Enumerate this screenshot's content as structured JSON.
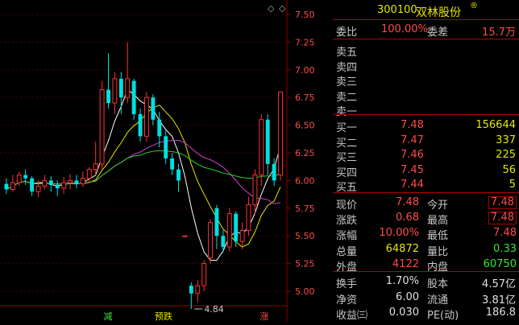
{
  "header": {
    "code": "300100",
    "name": "双林股份",
    "reg_mark": "®"
  },
  "chart": {
    "y_ticks": [
      "7.50",
      "7.25",
      "7.00",
      "6.75",
      "6.50",
      "6.25",
      "6.00",
      "5.75",
      "5.50",
      "5.25",
      "5.00"
    ],
    "low_marker": "4.84",
    "bottom_tags": [
      {
        "text": "减",
        "color": "#39e639"
      },
      {
        "text": "预跌",
        "color": "#e6e600"
      },
      {
        "text": "涨",
        "color": "#ff4b4b"
      }
    ],
    "colors": {
      "up": "#ff3232",
      "down": "#00e0e0",
      "ma5": "#ffffff",
      "ma10": "#e6e600",
      "ma20": "#d040d0",
      "ma60": "#30d030",
      "grid": "#8a0000"
    }
  },
  "panel": {
    "weibi": {
      "label": "委比",
      "value": "100.00%",
      "label2": "委差",
      "value2": "15.7万"
    },
    "sells": [
      {
        "label": "卖五",
        "price": "",
        "vol": ""
      },
      {
        "label": "卖四",
        "price": "",
        "vol": ""
      },
      {
        "label": "卖三",
        "price": "",
        "vol": ""
      },
      {
        "label": "卖二",
        "price": "",
        "vol": ""
      },
      {
        "label": "卖一",
        "price": "",
        "vol": ""
      }
    ],
    "buys": [
      {
        "label": "买一",
        "price": "7.48",
        "vol": "156644"
      },
      {
        "label": "买二",
        "price": "7.47",
        "vol": "337"
      },
      {
        "label": "买三",
        "price": "7.46",
        "vol": "225"
      },
      {
        "label": "买四",
        "price": "7.45",
        "vol": "56"
      },
      {
        "label": "买五",
        "price": "7.44",
        "vol": "5"
      }
    ],
    "stats": [
      {
        "l1": "现价",
        "v1": "7.48",
        "c1": "red",
        "l2": "今开",
        "v2": "7.48",
        "c2": "red",
        "box": true
      },
      {
        "l1": "涨跌",
        "v1": "0.68",
        "c1": "red",
        "l2": "最高",
        "v2": "7.48",
        "c2": "red",
        "box": true
      },
      {
        "l1": "涨幅",
        "v1": "10.00%",
        "c1": "red",
        "l2": "最低",
        "v2": "7.48",
        "c2": "red",
        "box": false
      },
      {
        "l1": "总量",
        "v1": "64872",
        "c1": "yellow",
        "l2": "量比",
        "v2": "0.33",
        "c2": "green",
        "box": false
      },
      {
        "l1": "外盘",
        "v1": "4122",
        "c1": "red",
        "l2": "内盘",
        "v2": "60750",
        "c2": "green",
        "box": false
      }
    ],
    "extra": [
      {
        "l1": "换手",
        "v1": "1.70%",
        "l2": "股本",
        "v2": "4.57亿"
      },
      {
        "l1": "净资",
        "v1": "6.00",
        "l2": "流通",
        "v2": "3.81亿"
      },
      {
        "l1": "收益㈢",
        "v1": "0.030",
        "l2": "PE(动)",
        "v2": "186.8"
      }
    ]
  },
  "candles": [
    {
      "o": 5.97,
      "c": 5.92,
      "h": 6.02,
      "l": 5.88
    },
    {
      "o": 5.92,
      "c": 5.98,
      "h": 6.05,
      "l": 5.9
    },
    {
      "o": 5.98,
      "c": 6.05,
      "h": 6.08,
      "l": 5.95
    },
    {
      "o": 6.05,
      "c": 6.02,
      "h": 6.1,
      "l": 5.96
    },
    {
      "o": 6.02,
      "c": 5.9,
      "h": 6.04,
      "l": 5.86
    },
    {
      "o": 5.9,
      "c": 5.95,
      "h": 6.0,
      "l": 5.85
    },
    {
      "o": 5.95,
      "c": 6.0,
      "h": 6.05,
      "l": 5.92
    },
    {
      "o": 6.0,
      "c": 5.96,
      "h": 6.04,
      "l": 5.9
    },
    {
      "o": 5.96,
      "c": 5.93,
      "h": 6.0,
      "l": 5.86
    },
    {
      "o": 5.93,
      "c": 5.98,
      "h": 6.03,
      "l": 5.88
    },
    {
      "o": 5.98,
      "c": 6.0,
      "h": 6.06,
      "l": 5.92
    },
    {
      "o": 6.0,
      "c": 5.97,
      "h": 6.05,
      "l": 5.93
    },
    {
      "o": 5.97,
      "c": 6.02,
      "h": 6.08,
      "l": 5.94
    },
    {
      "o": 6.02,
      "c": 6.1,
      "h": 6.12,
      "l": 5.98
    },
    {
      "o": 6.1,
      "c": 6.15,
      "h": 6.35,
      "l": 6.05
    },
    {
      "o": 6.15,
      "c": 6.82,
      "h": 6.9,
      "l": 6.1
    },
    {
      "o": 6.82,
      "c": 6.7,
      "h": 7.15,
      "l": 6.65
    },
    {
      "o": 6.7,
      "c": 6.92,
      "h": 6.98,
      "l": 6.6
    },
    {
      "o": 6.92,
      "c": 6.75,
      "h": 6.98,
      "l": 6.6
    },
    {
      "o": 6.75,
      "c": 6.92,
      "h": 7.25,
      "l": 6.7
    },
    {
      "o": 6.9,
      "c": 6.6,
      "h": 6.92,
      "l": 6.55
    },
    {
      "o": 6.6,
      "c": 6.4,
      "h": 6.65,
      "l": 6.35
    },
    {
      "o": 6.4,
      "c": 6.75,
      "h": 6.8,
      "l": 6.35
    },
    {
      "o": 6.75,
      "c": 6.55,
      "h": 6.78,
      "l": 6.5
    },
    {
      "o": 6.55,
      "c": 6.4,
      "h": 6.62,
      "l": 6.3
    },
    {
      "o": 6.4,
      "c": 6.2,
      "h": 6.45,
      "l": 6.15
    },
    {
      "o": 6.2,
      "c": 6.1,
      "h": 6.25,
      "l": 6.05
    },
    {
      "o": 6.1,
      "c": 6.0,
      "h": 6.15,
      "l": 5.9
    },
    {
      "o": 5.5,
      "c": 5.5,
      "h": 5.5,
      "l": 5.5
    },
    {
      "o": 5.05,
      "c": 4.98,
      "h": 5.08,
      "l": 4.84
    },
    {
      "o": 4.98,
      "c": 5.05,
      "h": 5.1,
      "l": 4.9
    },
    {
      "o": 5.05,
      "c": 5.25,
      "h": 5.28,
      "l": 5.0
    },
    {
      "o": 5.3,
      "c": 5.62,
      "h": 5.65,
      "l": 5.25
    },
    {
      "o": 5.75,
      "c": 5.5,
      "h": 5.78,
      "l": 5.38
    },
    {
      "o": 5.5,
      "c": 5.4,
      "h": 5.55,
      "l": 5.35
    },
    {
      "o": 5.4,
      "c": 5.7,
      "h": 5.75,
      "l": 5.36
    },
    {
      "o": 5.7,
      "c": 5.45,
      "h": 5.72,
      "l": 5.4
    },
    {
      "o": 5.45,
      "c": 5.55,
      "h": 5.62,
      "l": 5.38
    },
    {
      "o": 5.55,
      "c": 5.78,
      "h": 5.85,
      "l": 5.5
    },
    {
      "o": 5.78,
      "c": 6.05,
      "h": 6.1,
      "l": 5.7
    },
    {
      "o": 6.05,
      "c": 6.55,
      "h": 6.6,
      "l": 5.95
    },
    {
      "o": 6.55,
      "c": 6.15,
      "h": 6.6,
      "l": 6.05
    },
    {
      "o": 6.15,
      "c": 6.0,
      "h": 6.2,
      "l": 5.95
    },
    {
      "o": 6.05,
      "c": 6.8,
      "h": 6.8,
      "l": 6.0
    }
  ]
}
